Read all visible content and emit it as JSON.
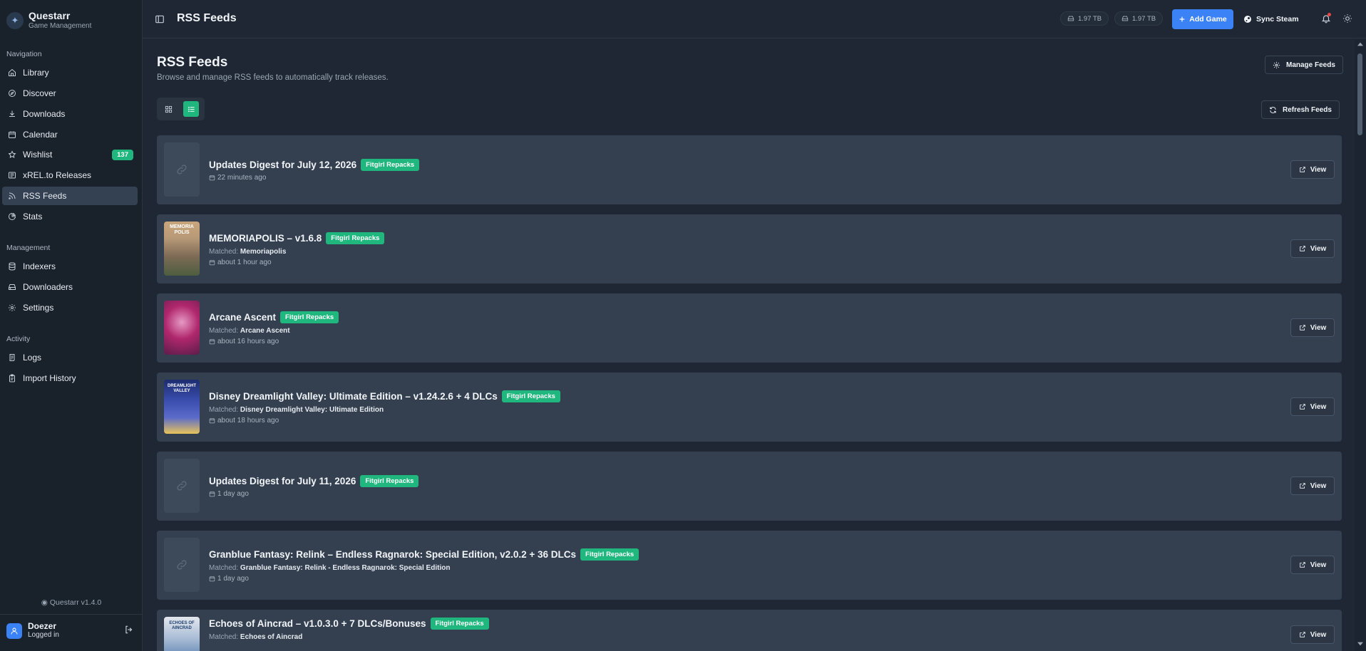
{
  "app": {
    "name": "Questarr",
    "subtitle": "Game Management"
  },
  "sidebar": {
    "sections": [
      {
        "label": "Navigation",
        "items": [
          {
            "label": "Library",
            "icon": "home-icon"
          },
          {
            "label": "Discover",
            "icon": "compass-icon"
          },
          {
            "label": "Downloads",
            "icon": "download-icon"
          },
          {
            "label": "Calendar",
            "icon": "calendar-icon"
          },
          {
            "label": "Wishlist",
            "icon": "star-icon",
            "badge": "137"
          },
          {
            "label": "xREL.to Releases",
            "icon": "newspaper-icon"
          },
          {
            "label": "RSS Feeds",
            "icon": "rss-icon",
            "active": true
          },
          {
            "label": "Stats",
            "icon": "pie-chart-icon"
          }
        ]
      },
      {
        "label": "Management",
        "items": [
          {
            "label": "Indexers",
            "icon": "database-icon"
          },
          {
            "label": "Downloaders",
            "icon": "hard-drive-icon"
          },
          {
            "label": "Settings",
            "icon": "gear-icon"
          }
        ]
      },
      {
        "label": "Activity",
        "items": [
          {
            "label": "Logs",
            "icon": "scroll-icon"
          },
          {
            "label": "Import History",
            "icon": "clipboard-icon"
          }
        ]
      }
    ],
    "version": "Questarr v1.4.0",
    "user": {
      "name": "Doezer",
      "status": "Logged in"
    }
  },
  "header": {
    "title": "RSS Feeds",
    "storage": [
      "1.97 TB",
      "1.97 TB"
    ],
    "add_game_label": "Add Game",
    "sync_steam_label": "Sync Steam"
  },
  "main": {
    "title": "RSS Feeds",
    "subtitle": "Browse and manage RSS feeds to automatically track releases.",
    "manage_feeds_label": "Manage Feeds",
    "refresh_feeds_label": "Refresh Feeds",
    "view_label": "View",
    "matched_prefix": "Matched:",
    "feeds": [
      {
        "title": "Updates Digest for July 12, 2026",
        "source": "Fitgirl Repacks",
        "matched": null,
        "time": "22 minutes ago",
        "thumb": "placeholder"
      },
      {
        "title": "MEMORIAPOLIS – v1.6.8",
        "source": "Fitgirl Repacks",
        "matched": "Memoriapolis",
        "time": "about 1 hour ago",
        "thumb": "cover",
        "cover_colors": [
          "#c9a57a",
          "#7d6a55",
          "#4d5e3f"
        ]
      },
      {
        "title": "Arcane Ascent",
        "source": "Fitgirl Repacks",
        "matched": "Arcane Ascent",
        "time": "about 16 hours ago",
        "thumb": "cover",
        "cover_colors": [
          "#b0276d",
          "#d86aa5",
          "#5c1d4a"
        ]
      },
      {
        "title": "Disney Dreamlight Valley: Ultimate Edition – v1.24.2.6 + 4 DLCs",
        "source": "Fitgirl Repacks",
        "matched": "Disney Dreamlight Valley: Ultimate Edition",
        "time": "about 18 hours ago",
        "thumb": "cover",
        "cover_colors": [
          "#253a8a",
          "#5b6bc9",
          "#e8c45a"
        ]
      },
      {
        "title": "Updates Digest for July 11, 2026",
        "source": "Fitgirl Repacks",
        "matched": null,
        "time": "1 day ago",
        "thumb": "placeholder"
      },
      {
        "title": "Granblue Fantasy: Relink – Endless Ragnarok: Special Edition, v2.0.2 + 36 DLCs",
        "source": "Fitgirl Repacks",
        "matched": "Granblue Fantasy: Relink - Endless Ragnarok: Special Edition",
        "time": "1 day ago",
        "thumb": "placeholder"
      },
      {
        "title": "Echoes of Aincrad – v1.0.3.0 + 7 DLCs/Bonuses",
        "source": "Fitgirl Repacks",
        "matched": "Echoes of Aincrad",
        "time": "",
        "thumb": "cover",
        "cover_colors": [
          "#d9dfe6",
          "#6d8fb7",
          "#c78f44"
        ]
      }
    ]
  },
  "colors": {
    "accent": "#1fb77e",
    "primary": "#3b82f6",
    "background": "#1e2733",
    "card": "#344050"
  }
}
